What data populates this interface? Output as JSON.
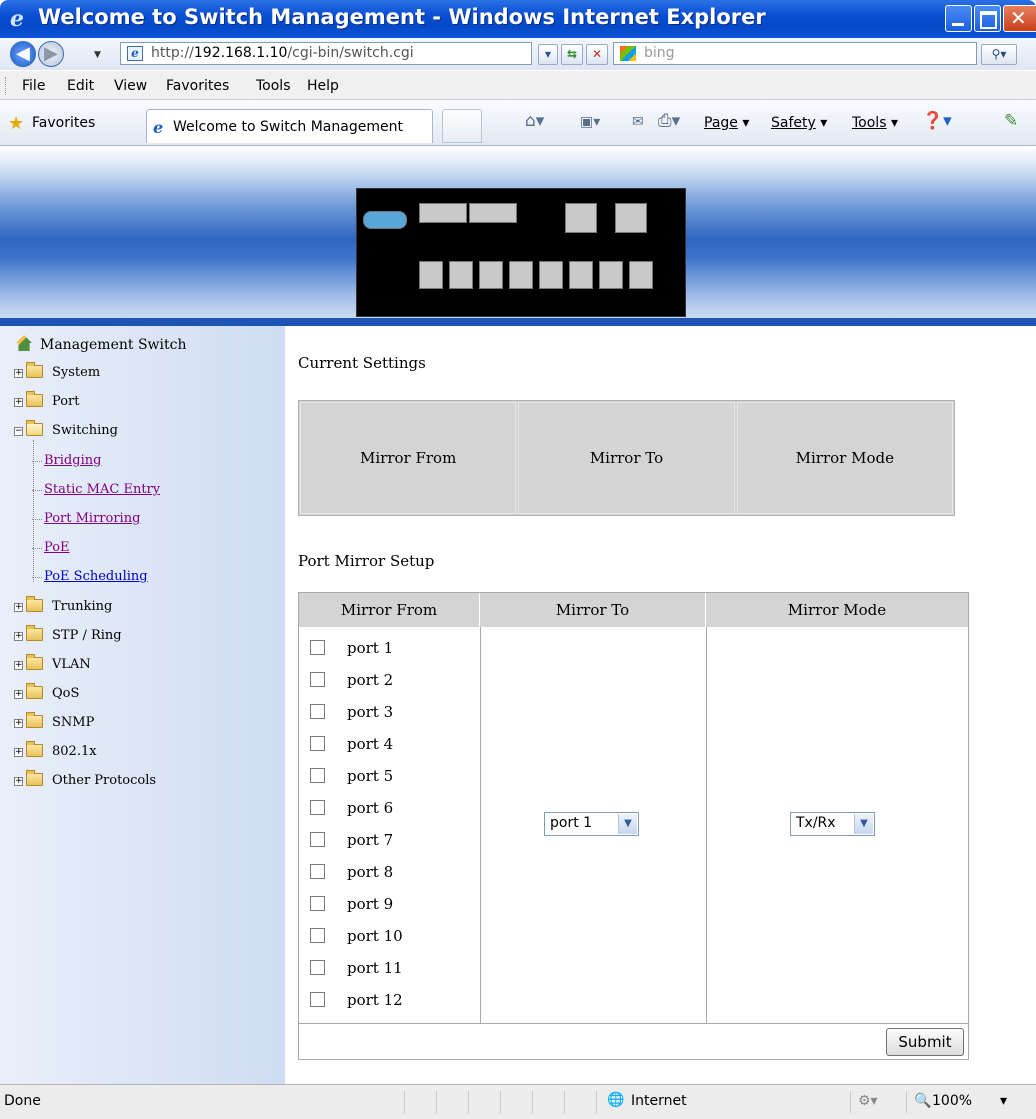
{
  "window": {
    "title": "Welcome to Switch Management - Windows Internet Explorer"
  },
  "address": {
    "url_prefix": "http://",
    "url_host": "192.168.1.10",
    "url_path": "/cgi-bin/switch.cgi",
    "search_placeholder": "bing"
  },
  "menu": [
    "File",
    "Edit",
    "View",
    "Favorites",
    "Tools",
    "Help"
  ],
  "favorites": {
    "label": "Favorites",
    "tab_title": "Welcome to Switch Management"
  },
  "commandbar": {
    "page": "Page",
    "safety": "Safety",
    "tools": "Tools"
  },
  "sidebar": {
    "root": "Management Switch",
    "items": [
      "System",
      "Port",
      "Switching",
      "Trunking",
      "STP / Ring",
      "VLAN",
      "QoS",
      "SNMP",
      "802.1x",
      "Other Protocols"
    ],
    "switching_children": [
      "Bridging",
      "Static MAC Entry",
      "Port Mirroring",
      "PoE",
      "PoE Scheduling"
    ]
  },
  "current": {
    "title": "Current Settings",
    "headers": [
      "Mirror From",
      "Mirror To",
      "Mirror Mode"
    ]
  },
  "setup": {
    "title": "Port Mirror Setup",
    "headers": [
      "Mirror From",
      "Mirror To",
      "Mirror Mode"
    ],
    "ports": [
      "port 1",
      "port 2",
      "port 3",
      "port 4",
      "port 5",
      "port 6",
      "port 7",
      "port 8",
      "port 9",
      "port 10",
      "port 11",
      "port 12"
    ],
    "mirror_to": "port 1",
    "mirror_mode": "Tx/Rx",
    "submit": "Submit"
  },
  "status": {
    "left": "Done",
    "zone": "Internet",
    "zoom": "100%"
  }
}
